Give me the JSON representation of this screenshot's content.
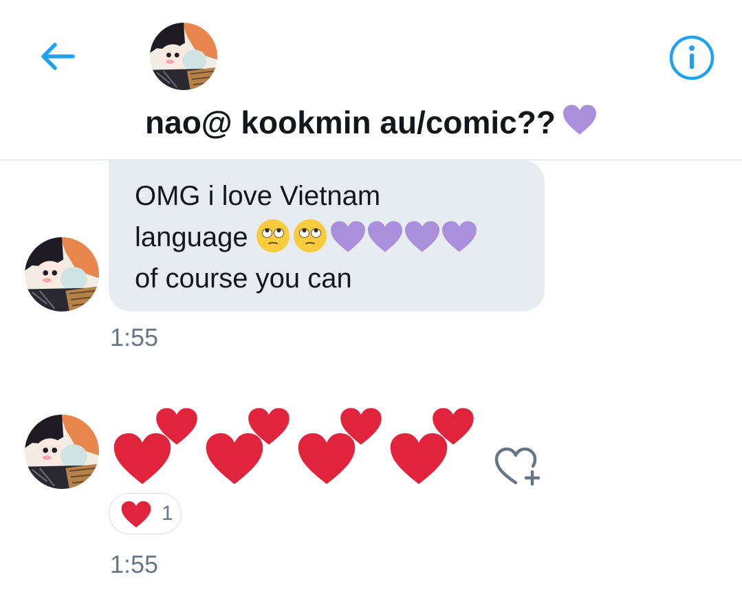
{
  "header": {
    "back_icon": "arrow-left-icon",
    "info_icon": "info-circle-icon",
    "title": "nao@ kookmin au/comic??",
    "title_emoji": "purple-heart",
    "accent_color": "#1da1f2"
  },
  "messages": [
    {
      "lines": [
        "OMG i love Vietnam",
        "language",
        "of course you can"
      ],
      "line2_emojis": [
        "face-with-rolling-eyes",
        "face-with-rolling-eyes",
        "purple-heart",
        "purple-heart",
        "purple-heart",
        "purple-heart"
      ],
      "time": "1:55",
      "bubble_color": "#e6ecf0"
    },
    {
      "emojis": [
        "two-hearts",
        "two-hearts",
        "two-hearts",
        "two-hearts"
      ],
      "reaction": {
        "icon": "red-heart",
        "count": "1"
      },
      "add_reaction_icon": "heart-plus-icon",
      "time": "1:55"
    }
  ],
  "colors": {
    "heart_red": "#e0243b",
    "heart_purple": "#a98fdc",
    "timestamp": "#657786"
  }
}
